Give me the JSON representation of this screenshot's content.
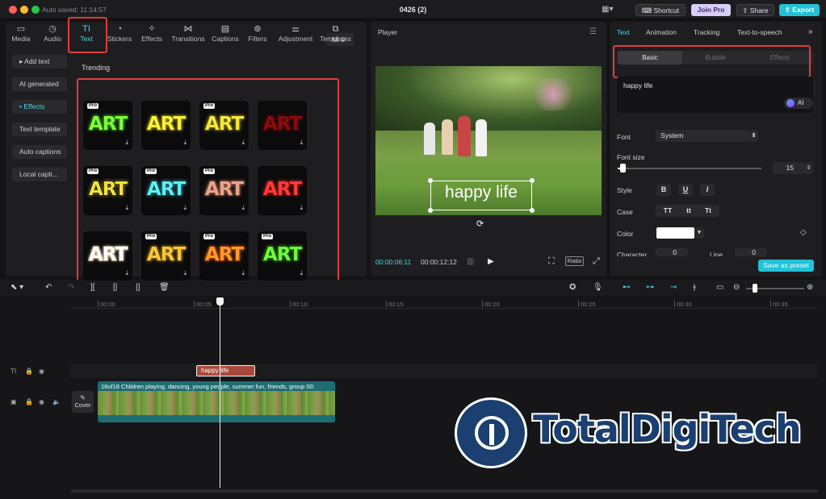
{
  "titlebar": {
    "autosave": "Auto saved: 11:14:57",
    "title": "0426 (2)",
    "shortcut": "Shortcut",
    "join_pro": "Join Pro",
    "share": "Share",
    "export": "Export"
  },
  "tools": [
    {
      "label": "Media",
      "icon": "▭"
    },
    {
      "label": "Audio",
      "icon": "◷"
    },
    {
      "label": "Text",
      "icon": "TI"
    },
    {
      "label": "Stickers",
      "icon": "◔"
    },
    {
      "label": "Effects",
      "icon": "✧"
    },
    {
      "label": "Transitions",
      "icon": "⋈"
    },
    {
      "label": "Captions",
      "icon": "▤"
    },
    {
      "label": "Filters",
      "icon": "⊛"
    },
    {
      "label": "Adjustment",
      "icon": "⚌"
    },
    {
      "label": "Templates",
      "icon": "⧉"
    }
  ],
  "sidebar": [
    {
      "label": "▸ Add text"
    },
    {
      "label": "AI generated"
    },
    {
      "label": "• Effects"
    },
    {
      "label": "Text template"
    },
    {
      "label": "Auto captions"
    },
    {
      "label": "Local capti..."
    }
  ],
  "filter": {
    "label": "All"
  },
  "trending": {
    "title": "Trending",
    "tiles": [
      {
        "text": "ART",
        "pro": "Pro",
        "color": "#7dff3a",
        "stroke": "#1b5e0d"
      },
      {
        "text": "ART",
        "pro": "",
        "color": "#f7f23a",
        "stroke": "#6b5a00"
      },
      {
        "text": "ART",
        "pro": "Pro",
        "color": "#f6e63c",
        "stroke": "#4d4d00"
      },
      {
        "text": "ART",
        "pro": "",
        "color": "#8a0c0c",
        "stroke": "#3a0505"
      },
      {
        "text": "ART",
        "pro": "Pro",
        "color": "#f4e23a",
        "stroke": "#1d1d1d"
      },
      {
        "text": "ART",
        "pro": "Pro",
        "color": "#5ff0f0",
        "stroke": "#0b3d4a"
      },
      {
        "text": "ART",
        "pro": "Pro",
        "color": "#e8a48c",
        "stroke": "#6a3a2a"
      },
      {
        "text": "ART",
        "pro": "",
        "color": "#ff3a3a",
        "stroke": "#6a0a0a"
      },
      {
        "text": "ART",
        "pro": "",
        "color": "#ffffff",
        "stroke": "#b8a080"
      },
      {
        "text": "ART",
        "pro": "Pro",
        "color": "#f8c83a",
        "stroke": "#6a4a00"
      },
      {
        "text": "ART",
        "pro": "Pro",
        "color": "#ff9a2a",
        "stroke": "#8a2a00"
      },
      {
        "text": "ART",
        "pro": "Pro",
        "color": "#6cff3a",
        "stroke": "#1a4a0a"
      }
    ]
  },
  "player": {
    "title": "Player",
    "caption": "happy life",
    "current_time": "00:00:06:11",
    "total_time": "00:00:12:12",
    "ratio": "Ratio"
  },
  "properties": {
    "tabs": [
      "Text",
      "Animation",
      "Tracking",
      "Text-to-speech"
    ],
    "subtabs": [
      "Basic",
      "Bubble",
      "Effects"
    ],
    "text_value": "happy life",
    "ai_label": "AI",
    "font_label": "Font",
    "font_value": "System",
    "size_label": "Font size",
    "size_value": "15",
    "style_label": "Style",
    "style_buttons": [
      "B",
      "U",
      "I"
    ],
    "case_label": "Case",
    "case_buttons": [
      "TT",
      "tt",
      "Tt"
    ],
    "color_label": "Color",
    "character_label": "Character",
    "character_value": "0",
    "line_label": "Line",
    "line_value": "0",
    "save_preset": "Save as preset"
  },
  "timeline": {
    "ticks": [
      "00:00",
      "00:05",
      "00:10",
      "00:15",
      "00:20",
      "00:25",
      "00:30",
      "00:35"
    ],
    "text_clip": "happy life",
    "video_clip": "16of18 Children playing, dancing, young people, summer fun, friends, group",
    "video_clip_duration": "00:",
    "cover": "Cover"
  },
  "watermark": {
    "text": "TotalDigiTech"
  },
  "colors": {
    "accent": "#4fd6e8",
    "highlight": "#e23c3c",
    "clip_text": "#a9473b",
    "clip_video": "#1e6d72"
  }
}
